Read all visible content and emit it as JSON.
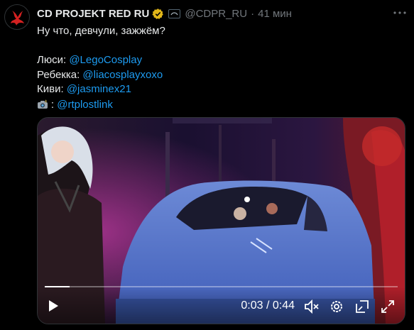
{
  "author": {
    "name": "CD PROJEKT RED RU",
    "handle": "@CDPR_RU",
    "separator": "·",
    "time": "41 мин"
  },
  "tweet": {
    "line1": "Ну что, девчули, зажжём?",
    "credits": [
      {
        "label": "Люси: ",
        "link": "@LegoCosplay"
      },
      {
        "label": "Ребекка: ",
        "link": "@liacosplayxoxo"
      },
      {
        "label": "Киви: ",
        "link": "@jasminex21"
      },
      {
        "label": ": ",
        "link": "@rtplostlink",
        "icon": "camera-flash-icon"
      }
    ]
  },
  "video": {
    "current_time": "0:03",
    "time_separator": " / ",
    "duration": "0:44",
    "progress": 0.07,
    "icons": [
      "play-icon",
      "mute-icon",
      "settings-icon",
      "popout-icon",
      "fullscreen-icon"
    ]
  },
  "colors": {
    "link": "#1d9bf0",
    "verified": "#e2b719",
    "text": "#e7e9ea",
    "muted": "#71767b"
  }
}
